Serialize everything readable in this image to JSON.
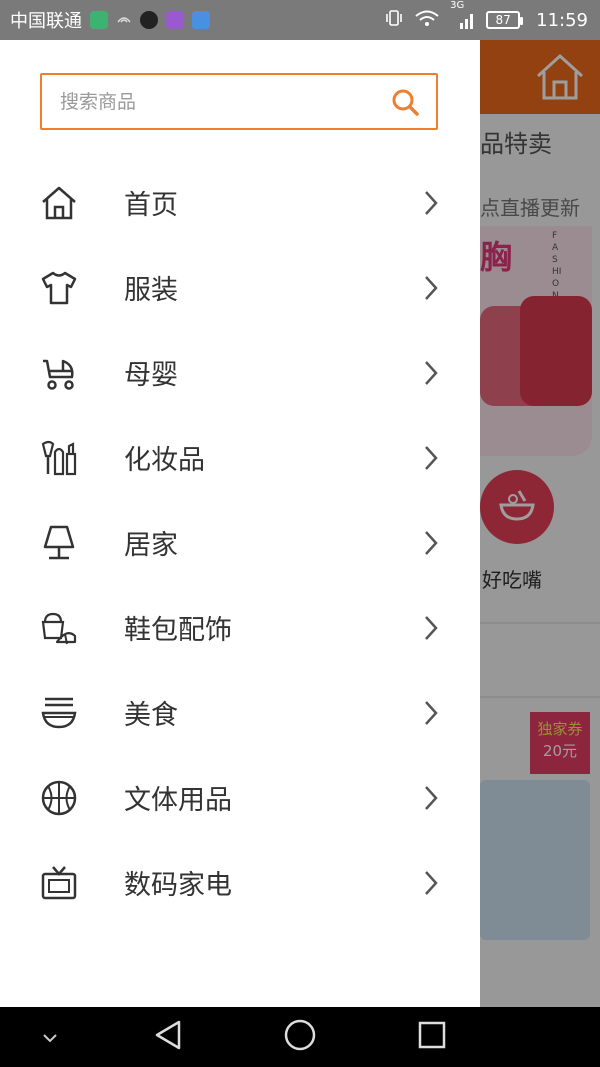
{
  "status_bar": {
    "carrier": "中国联通",
    "network": "3G",
    "battery": "87",
    "time": "11:59"
  },
  "search": {
    "placeholder": "搜索商品"
  },
  "menu": [
    {
      "label": "首页",
      "icon": "home-icon"
    },
    {
      "label": "服装",
      "icon": "tshirt-icon"
    },
    {
      "label": "母婴",
      "icon": "stroller-icon"
    },
    {
      "label": "化妆品",
      "icon": "cosmetics-icon"
    },
    {
      "label": "居家",
      "icon": "lamp-icon"
    },
    {
      "label": "鞋包配饰",
      "icon": "shoe-bag-icon"
    },
    {
      "label": "美食",
      "icon": "noodle-bowl-icon"
    },
    {
      "label": "文体用品",
      "icon": "basketball-icon"
    },
    {
      "label": "数码家电",
      "icon": "tv-icon"
    }
  ],
  "background": {
    "section_title": "品特卖",
    "live_text": "点直播更新",
    "banner_text": "胸",
    "banner_vertical": "FASHION",
    "category_label": "好吃嘴",
    "badge_line1": "独家券",
    "badge_line2": "20元"
  },
  "colors": {
    "accent": "#ef7f2c",
    "header_orange": "#ef6a1c",
    "text": "#333333",
    "badge": "#e63d66"
  }
}
